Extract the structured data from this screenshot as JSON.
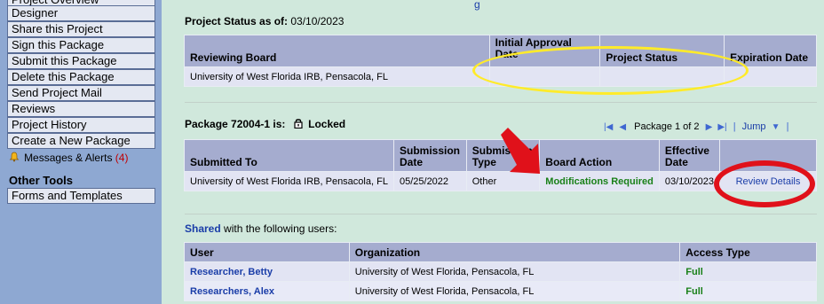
{
  "sidebar": {
    "items": [
      {
        "label": "Project Overview"
      },
      {
        "label": "Designer"
      },
      {
        "label": "Share this Project"
      },
      {
        "label": "Sign this Package"
      },
      {
        "label": "Submit this Package"
      },
      {
        "label": "Delete this Package"
      },
      {
        "label": "Send Project Mail"
      },
      {
        "label": "Reviews"
      },
      {
        "label": "Project History"
      },
      {
        "label": "Create a New Package"
      }
    ],
    "messages": {
      "label": "Messages & Alerts",
      "count": "(4)"
    },
    "other_tools": {
      "heading": "Other Tools",
      "items": [
        {
          "label": "Forms and Templates"
        }
      ]
    }
  },
  "top_fragment": "g",
  "project_status": {
    "heading_label": "Project Status as of:",
    "heading_date": "03/10/2023",
    "columns": [
      "Reviewing Board",
      "Initial Approval Date",
      "Project Status",
      "Expiration Date"
    ],
    "rows": [
      {
        "board": "University of West Florida IRB, Pensacola, FL",
        "initial_approval": "",
        "status": "",
        "expiration": ""
      }
    ]
  },
  "package": {
    "heading_label": "Package 72004-1 is:",
    "lock_state": "Locked",
    "pager": {
      "text": "Package 1 of 2",
      "jump": "Jump"
    },
    "columns": [
      "Submitted To",
      "Submission Date",
      "Submission Type",
      "Board Action",
      "Effective Date",
      ""
    ],
    "rows": [
      {
        "submitted_to": "University of West Florida IRB, Pensacola, FL",
        "date": "05/25/2022",
        "type": "Other",
        "action": "Modifications Required",
        "effective": "03/10/2023",
        "details": "Review Details"
      }
    ]
  },
  "shared": {
    "label_highlight": "Shared",
    "label_rest": "with the following users:",
    "columns": [
      "User",
      "Organization",
      "Access Type"
    ],
    "rows": [
      {
        "user": "Researcher, Betty",
        "org": "University of West Florida, Pensacola, FL",
        "access": "Full"
      },
      {
        "user": "Researchers, Alex",
        "org": "University of West Florida, Pensacola, FL",
        "access": "Full"
      }
    ]
  },
  "colors": {
    "sidebar_bg": "#8ea8d2",
    "page_bg": "#d0e8dc",
    "header_bg": "#a5accf",
    "row_bg": "#e2e4f3",
    "link": "#1a3da8",
    "status_green": "#198018",
    "annotation_yellow": "#ffeb2a",
    "annotation_red": "#e0111a"
  },
  "icons": [
    "bell-icon",
    "lock-icon",
    "first-page-icon",
    "prev-page-icon",
    "next-page-icon",
    "last-page-icon",
    "jump-dropdown-icon"
  ]
}
